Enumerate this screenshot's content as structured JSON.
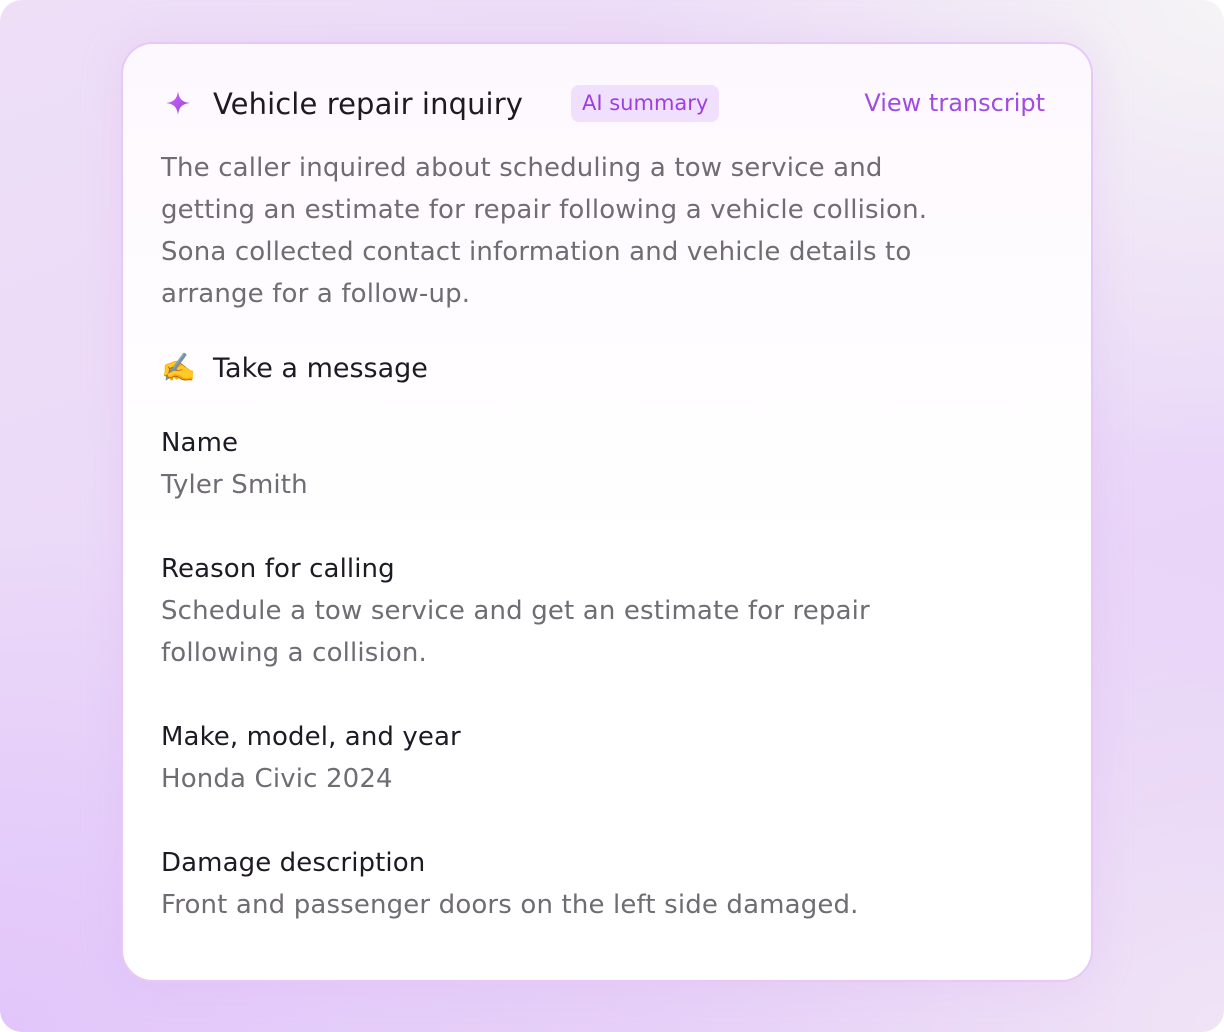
{
  "card": {
    "icon": "sparkle-icon",
    "title": "Vehicle repair inquiry",
    "badge": "AI summary",
    "view_transcript_link": "View transcript",
    "summary_lines": [
      "The caller inquired about scheduling a tow service and",
      "getting an estimate for repair following a vehicle collision.",
      "Sona collected contact information and vehicle details to",
      "arrange for a follow-up."
    ]
  },
  "section": {
    "emoji": "✍️",
    "icon": "writing-hand-icon",
    "title": "Take a message"
  },
  "fields": [
    {
      "label": "Name",
      "value": "Tyler Smith"
    },
    {
      "label": "Reason for calling",
      "value_lines": [
        "Schedule a tow service and get an estimate for repair",
        "following a collision."
      ]
    },
    {
      "label": "Make, model, and year",
      "value": "Honda Civic 2024"
    },
    {
      "label": "Damage description",
      "value": "Front and passenger doors on the left side damaged."
    }
  ],
  "colors": {
    "accent": "#9d3fe0",
    "badge_bg": "#f1e0fd",
    "link": "#a04ce2",
    "heading_text": "#1e1a24",
    "body_text": "#6f6c73",
    "card_border": "#e6c9f7"
  }
}
